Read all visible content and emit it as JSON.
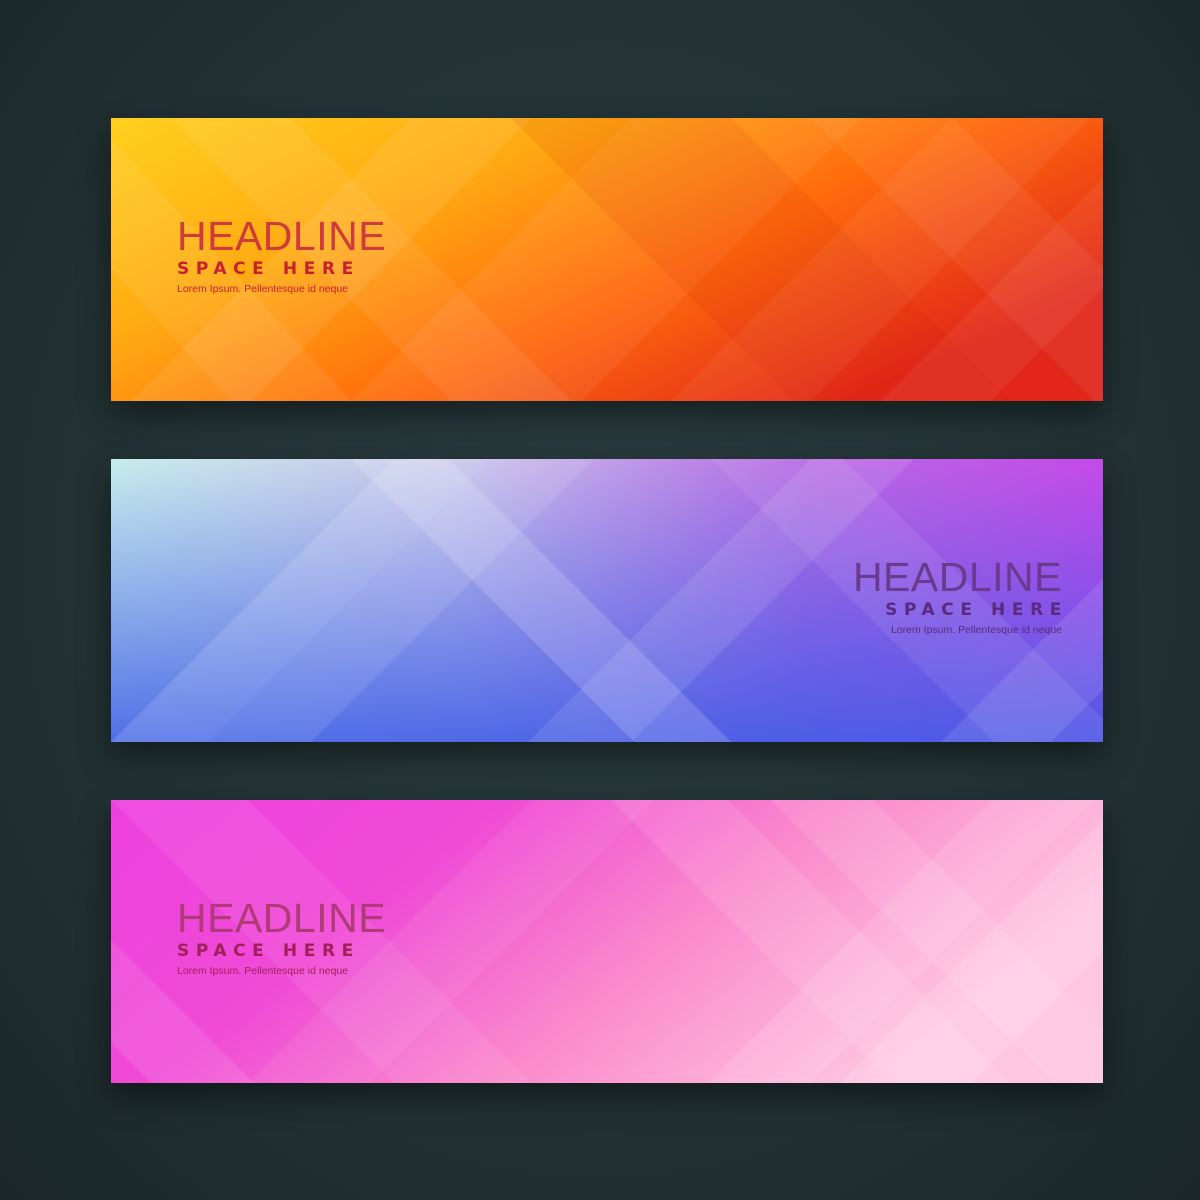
{
  "banners": [
    {
      "id": "orange",
      "headline": "HEADLINE",
      "subhead": "SPACE HERE",
      "body": "Lorem Ipsum. Pellentesque id neque",
      "colors": {
        "start": "#ffc81e",
        "mid": "#ff8a12",
        "end": "#e8301a",
        "text": "#c8202e"
      }
    },
    {
      "id": "blue",
      "headline": "HEADLINE",
      "subhead": "SPACE HERE",
      "body": "Lorem Ipsum. Pellentesque id neque",
      "colors": {
        "start": "#c6e6ea",
        "mid": "#5a6ee0",
        "end": "#c848e6",
        "text": "#5a2a7e"
      }
    },
    {
      "id": "pink",
      "headline": "HEADLINE",
      "subhead": "SPACE HERE",
      "body": "Lorem Ipsum. Pellentesque id neque",
      "colors": {
        "start": "#ec3ae0",
        "mid": "#f46ac6",
        "end": "#ffc4e0",
        "text": "#a0205a"
      }
    }
  ]
}
